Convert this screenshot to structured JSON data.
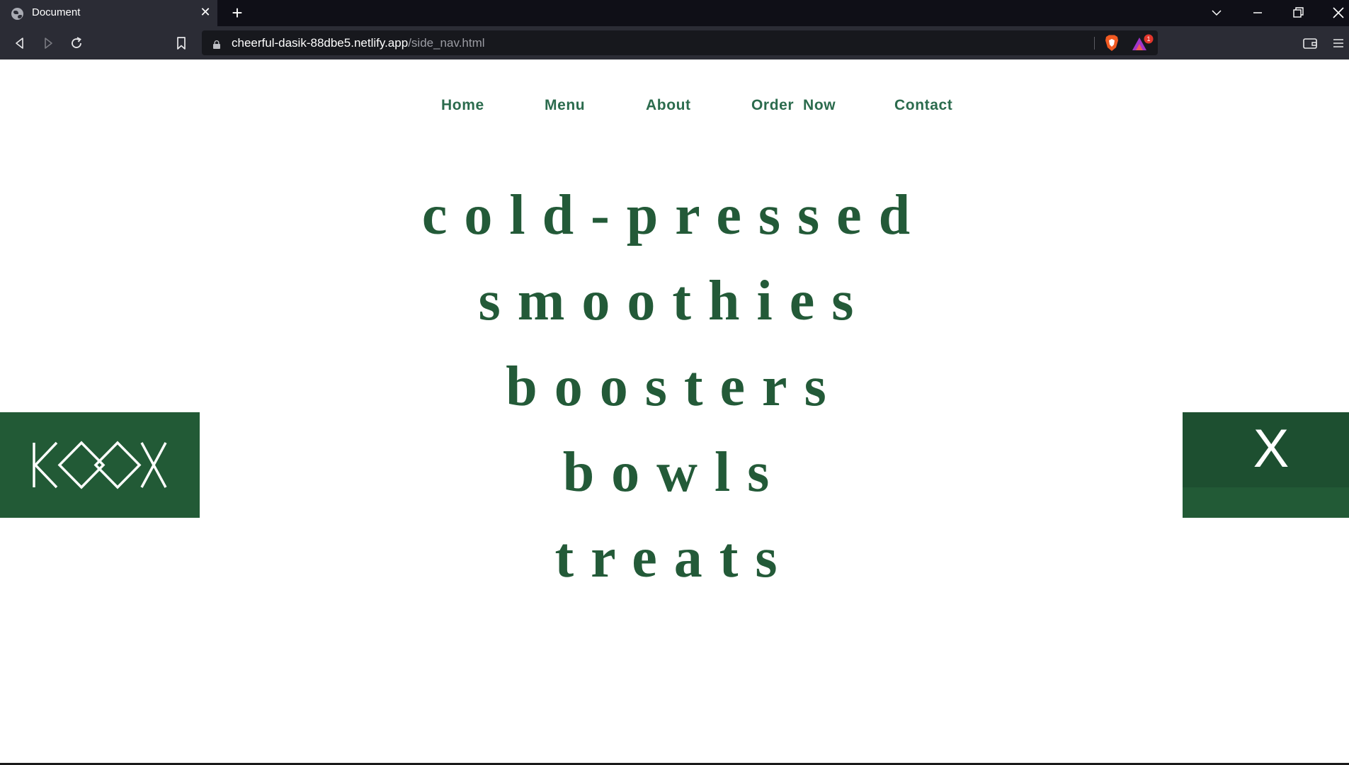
{
  "browser": {
    "tab": {
      "title": "Document",
      "close_glyph": "✕"
    },
    "new_tab_glyph": "+",
    "url": {
      "host": "cheerful-dasik-88dbe5.netlify.app",
      "path": "/side_nav.html"
    },
    "shield_badge_count": "1",
    "icons": [
      "globe-icon",
      "close-icon",
      "plus-icon",
      "chevron-down-icon",
      "minimize-icon",
      "restore-icon",
      "window-close-icon",
      "back-icon",
      "forward-icon",
      "reload-icon",
      "bookmark-icon",
      "lock-icon",
      "brave-shield-icon",
      "rewards-icon",
      "wallet-icon",
      "menu-icon"
    ]
  },
  "nav": {
    "items": [
      {
        "label": "Home"
      },
      {
        "label": "Menu"
      },
      {
        "label": "About"
      },
      {
        "label": "Order  Now"
      },
      {
        "label": "Contact"
      }
    ]
  },
  "hero": {
    "lines": [
      "cold-pressed",
      "smoothies",
      "boosters",
      "bowls",
      "treats"
    ]
  },
  "logo": {
    "text": "KOOX"
  },
  "close_button": {
    "label": "X"
  },
  "colors": {
    "brand_green": "#225a36",
    "hero_text": "#235a38",
    "nav_text": "#2b6b4d"
  }
}
